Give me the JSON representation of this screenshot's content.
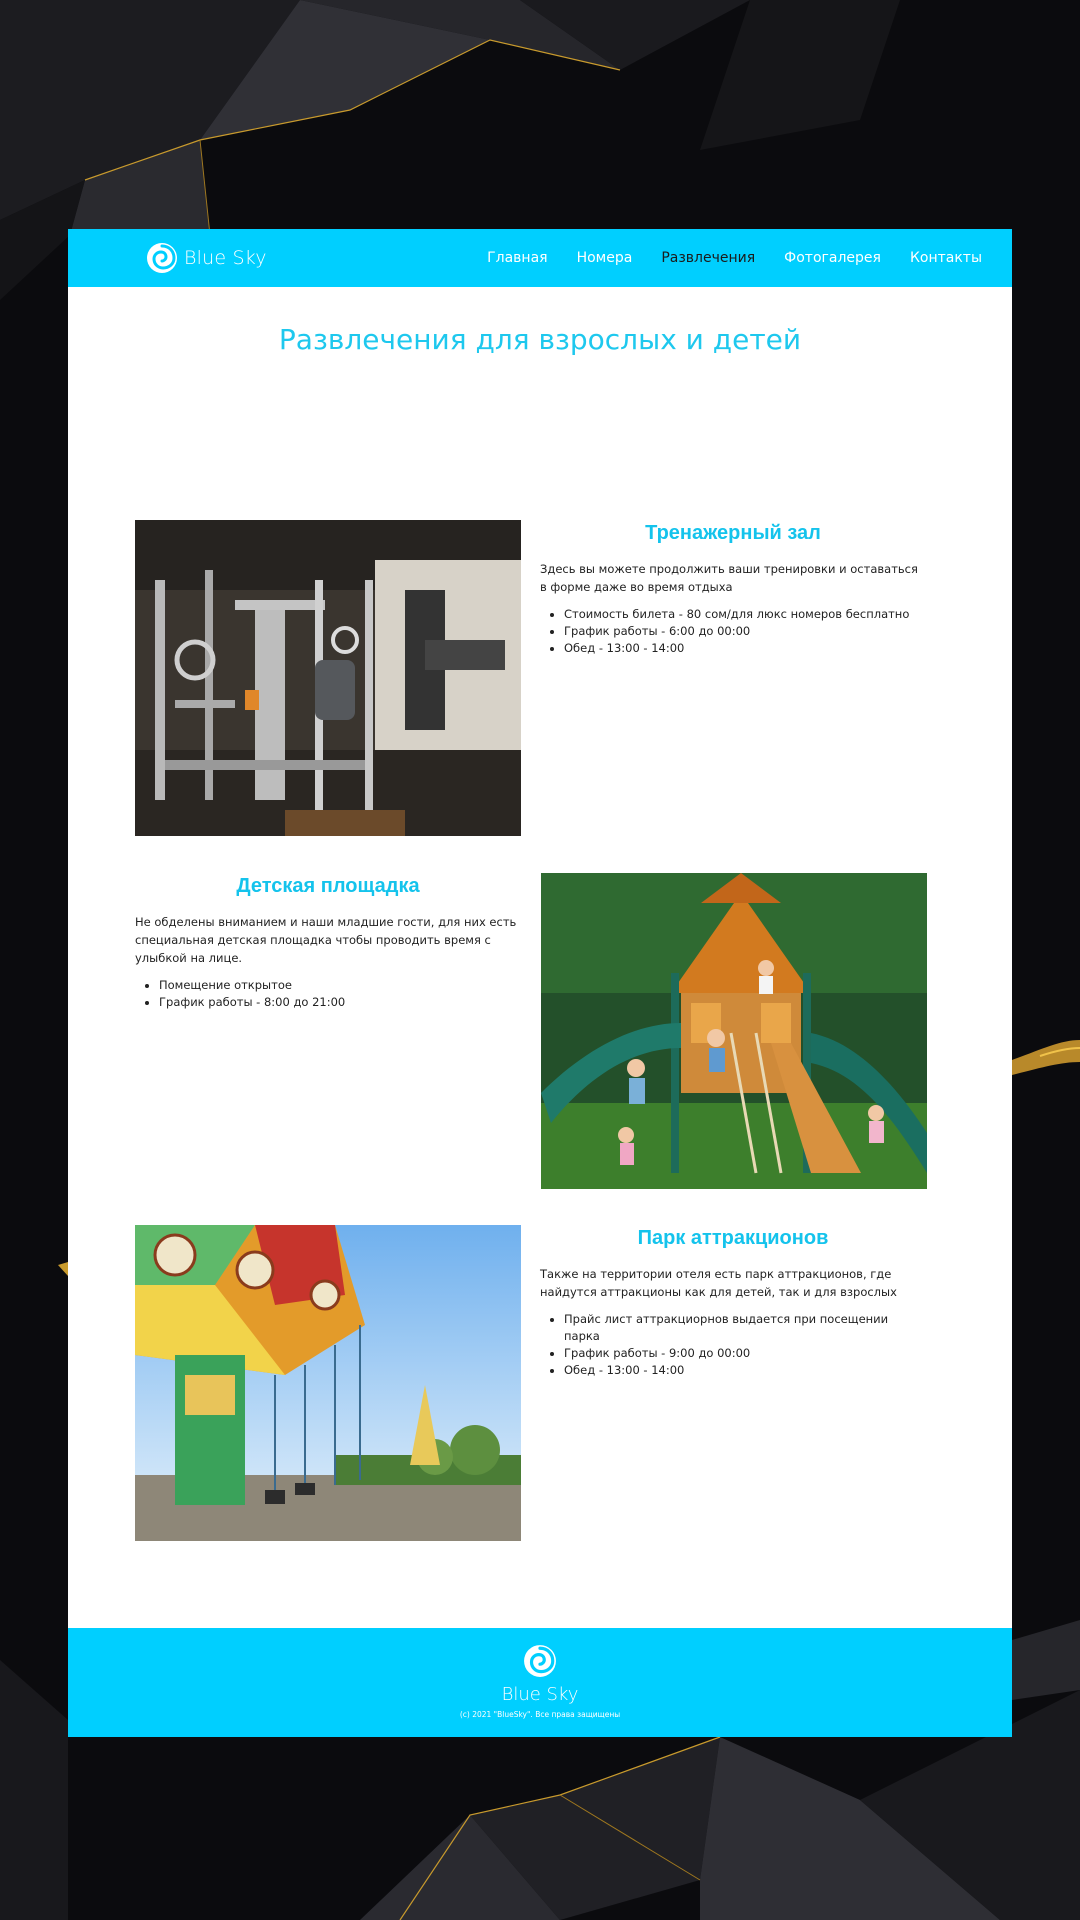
{
  "brand": {
    "name": "Blue Sky",
    "accent_color": "#00cfff",
    "title_color": "#1ec8ee",
    "logo_icon": "swirl-logo-icon"
  },
  "nav": {
    "items": [
      {
        "label": "Главная",
        "active": false
      },
      {
        "label": "Номера",
        "active": false
      },
      {
        "label": "Развлечения",
        "active": true
      },
      {
        "label": "Фотогалерея",
        "active": false
      },
      {
        "label": "Контакты",
        "active": false
      }
    ]
  },
  "page": {
    "title": "Развлечения для взрослых и детей"
  },
  "sections": [
    {
      "title": "Тренажерный зал",
      "description": "Здесь вы можете продолжить ваши тренировки и оставаться в форме даже во время отдыха",
      "bullets": [
        "Стоимость билета - 80 сом/для люкс номеров бесплатно",
        "График работы - 6:00 до 00:00",
        "Обед - 13:00 - 14:00"
      ],
      "image": "gym-equipment-photo"
    },
    {
      "title": "Детская площадка",
      "description": "Не обделены вниманием и наши младшие гости, для них есть специальная детская площадка чтобы проводить время с улыбкой на лице.",
      "bullets": [
        "Помещение открытое",
        "График работы - 8:00 до 21:00"
      ],
      "image": "playground-photo"
    },
    {
      "title": "Парк аттракционов",
      "description": "Также на территории отеля есть парк аттракционов, где найдутся аттракционы как для детей, так и для взрослых",
      "bullets": [
        "Прайс лист аттракциорнов выдается при посещении парка",
        "График работы - 9:00 до 00:00",
        "Обед - 13:00 - 14:00"
      ],
      "image": "carousel-photo"
    }
  ],
  "footer": {
    "name": "Blue Sky",
    "copyright": "(c) 2021 \"BlueSky\". Все права защищены"
  }
}
